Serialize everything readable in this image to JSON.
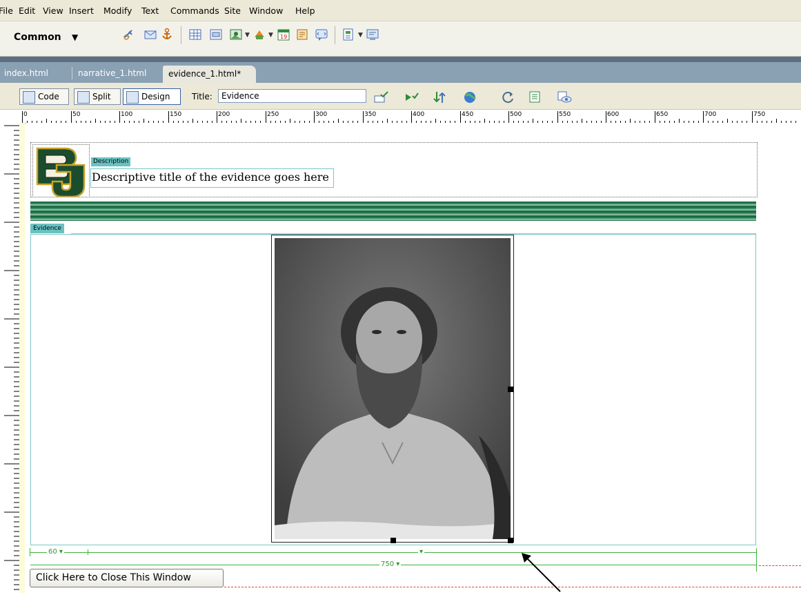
{
  "menu": [
    "File",
    "Edit",
    "View",
    "Insert",
    "Modify",
    "Text",
    "Commands",
    "Site",
    "Window",
    "Help"
  ],
  "insert_bar": {
    "category": "Common",
    "icons": [
      "hyperlink-icon",
      "email-link-icon",
      "named-anchor-icon",
      "table-icon",
      "layer-icon",
      "image-icon",
      "media-icon",
      "date-icon",
      "comment-icon",
      "tag-chooser-icon",
      "template-icon",
      "widget-icon"
    ],
    "accent": "#f3f2ea"
  },
  "tabs": [
    "index.html",
    "narrative_1.html",
    "evidence_1.html*"
  ],
  "doc_toolbar": {
    "views": [
      "Code",
      "Split",
      "Design"
    ],
    "title_label": "Title:",
    "title_value": "Evidence"
  },
  "ruler": [
    "0",
    "50",
    "100",
    "150",
    "200",
    "250",
    "300",
    "350",
    "400",
    "450",
    "500",
    "550",
    "600",
    "650",
    "700",
    "750"
  ],
  "page": {
    "description_tag": "Description",
    "description_text": "Descriptive title of the evidence goes here",
    "evidence_tag": "Evidence",
    "width_left": "60",
    "width_table": "750",
    "close_button": "Click Here to Close This Window",
    "colors": {
      "stripe": "#1e7a4a",
      "editable_region": "#69c1c2",
      "guide": "#3bb13b"
    }
  }
}
